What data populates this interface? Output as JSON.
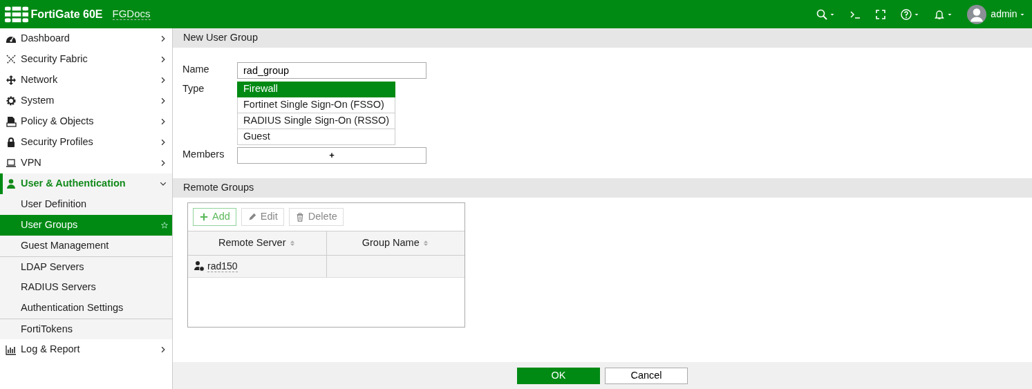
{
  "header": {
    "product": "FortiGate 60E",
    "host": "FGDocs",
    "user": "admin"
  },
  "sidebar": {
    "items": [
      {
        "label": "Dashboard",
        "expanded": false
      },
      {
        "label": "Security Fabric",
        "expanded": false
      },
      {
        "label": "Network",
        "expanded": false
      },
      {
        "label": "System",
        "expanded": false
      },
      {
        "label": "Policy & Objects",
        "expanded": false
      },
      {
        "label": "Security Profiles",
        "expanded": false
      },
      {
        "label": "VPN",
        "expanded": false
      },
      {
        "label": "User & Authentication",
        "expanded": true,
        "children": [
          {
            "label": "User Definition",
            "selected": false,
            "divider_before": false
          },
          {
            "label": "User Groups",
            "selected": true,
            "divider_before": false
          },
          {
            "label": "Guest Management",
            "selected": false,
            "divider_before": false
          },
          {
            "label": "LDAP Servers",
            "selected": false,
            "divider_before": true
          },
          {
            "label": "RADIUS Servers",
            "selected": false,
            "divider_before": false
          },
          {
            "label": "Authentication Settings",
            "selected": false,
            "divider_before": false
          },
          {
            "label": "FortiTokens",
            "selected": false,
            "divider_before": true
          }
        ]
      },
      {
        "label": "Log & Report",
        "expanded": false
      }
    ]
  },
  "form": {
    "title": "New User Group",
    "name": {
      "label": "Name",
      "value": "rad_group"
    },
    "type": {
      "label": "Type",
      "options": [
        {
          "label": "Firewall",
          "selected": true
        },
        {
          "label": "Fortinet Single Sign-On (FSSO)",
          "selected": false
        },
        {
          "label": "RADIUS Single Sign-On (RSSO)",
          "selected": false
        },
        {
          "label": "Guest",
          "selected": false
        }
      ]
    },
    "members": {
      "label": "Members",
      "add": "+"
    }
  },
  "remote_groups": {
    "title": "Remote Groups",
    "toolbar": [
      {
        "label": "Add",
        "disabled": false
      },
      {
        "label": "Edit",
        "disabled": true
      },
      {
        "label": "Delete",
        "disabled": true
      }
    ],
    "columns": [
      "Remote Server",
      "Group Name"
    ],
    "rows": [
      {
        "remote_server": "rad150"
      }
    ]
  },
  "footer": {
    "buttons": [
      {
        "label": "OK",
        "kind": "primary"
      },
      {
        "label": "Cancel",
        "kind": "secondary"
      }
    ]
  }
}
